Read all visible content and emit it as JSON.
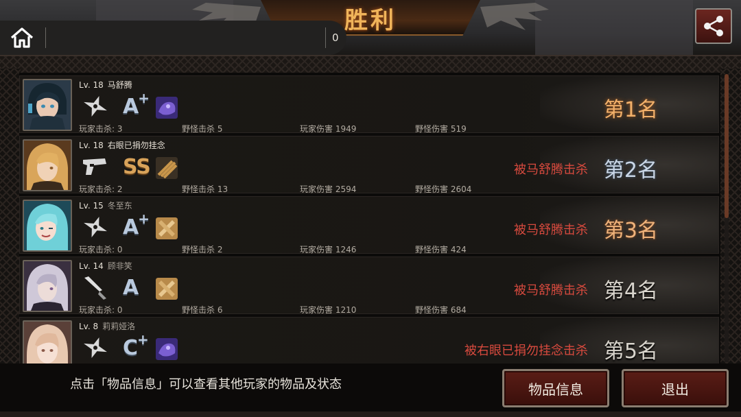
{
  "header": {
    "title": "胜利",
    "score": "0"
  },
  "players": [
    {
      "level_label": "Lv. 18",
      "name": "马舒腾",
      "weapon": "shuriken",
      "grade": "A",
      "grade_plus": "+",
      "item": "purple-chip",
      "player_kills": "玩家击杀: 3",
      "monster_kills": "野怪击杀 5",
      "player_damage": "玩家伤害 1949",
      "monster_damage": "野怪伤害 519",
      "killed_by": "",
      "rank": "第1名"
    },
    {
      "level_label": "Lv. 18",
      "name": "右眼已捐勿挂念",
      "weapon": "pistol",
      "grade": "SS",
      "grade_plus": "",
      "item": "ammo-box",
      "player_kills": "玩家击杀: 2",
      "monster_kills": "野怪击杀 13",
      "player_damage": "玩家伤害 2594",
      "monster_damage": "野怪伤害 2604",
      "killed_by": "被马舒腾击杀",
      "rank": "第2名"
    },
    {
      "level_label": "Lv. 15",
      "name": "冬至东",
      "weapon": "shuriken",
      "grade": "A",
      "grade_plus": "+",
      "item": "bandage",
      "player_kills": "玩家击杀: 0",
      "monster_kills": "野怪击杀 2",
      "player_damage": "玩家伤害 1246",
      "monster_damage": "野怪伤害 424",
      "killed_by": "被马舒腾击杀",
      "rank": "第3名"
    },
    {
      "level_label": "Lv. 14",
      "name": "顾非笑",
      "weapon": "knife",
      "grade": "A",
      "grade_plus": "",
      "item": "bandage",
      "player_kills": "玩家击杀: 0",
      "monster_kills": "野怪击杀 6",
      "player_damage": "玩家伤害 1210",
      "monster_damage": "野怪伤害 684",
      "killed_by": "被马舒腾击杀",
      "rank": "第4名"
    },
    {
      "level_label": "Lv. 8",
      "name": "莉莉娅洛",
      "weapon": "shuriken",
      "grade": "C",
      "grade_plus": "+",
      "item": "purple-chip",
      "player_kills": "",
      "monster_kills": "",
      "player_damage": "",
      "monster_damage": "",
      "killed_by": "被右眼已捐勿挂念击杀",
      "rank": "第5名"
    }
  ],
  "footer": {
    "hint": "点击「物品信息」可以查看其他玩家的物品及状态",
    "items_button": "物品信息",
    "exit_button": "退出"
  },
  "colors": {
    "accent": "#f0b45a",
    "kill_text": "#d84a3e",
    "button_bg": "#5a1d16"
  }
}
